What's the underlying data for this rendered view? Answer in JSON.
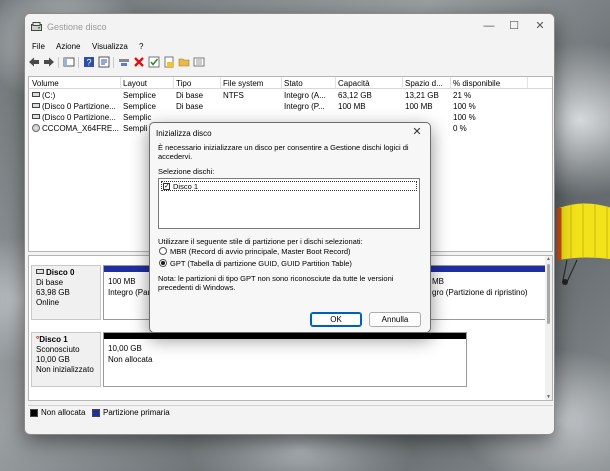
{
  "window": {
    "title": "Gestione disco",
    "minimize": "—",
    "maximize": "☐",
    "close": "✕"
  },
  "menu": [
    "File",
    "Azione",
    "Visualizza",
    "?"
  ],
  "toolbar": [
    "back-arrow-icon",
    "forward-arrow-icon",
    "show-hide-tree-icon",
    "help-icon",
    "properties-icon",
    "connect-icon",
    "delete-icon",
    "check-icon",
    "export-icon",
    "folder-icon",
    "view-list-icon"
  ],
  "volume_list": {
    "columns": [
      "Volume",
      "Layout",
      "Tipo",
      "File system",
      "Stato",
      "Capacità",
      "Spazio d...",
      "% disponibile"
    ],
    "rows": [
      [
        "(C:)",
        "Semplice",
        "Di base",
        "NTFS",
        "Integro (A...",
        "63,12 GB",
        "13,21 GB",
        "21 %"
      ],
      [
        "(Disco 0 Partizione...",
        "Semplice",
        "Di base",
        "",
        "Integro (P...",
        "100 MB",
        "100 MB",
        "100 %"
      ],
      [
        "(Disco 0 Partizione...",
        "Semplic",
        "",
        "",
        "",
        "",
        "",
        "100 %"
      ],
      [
        "CCCOMA_X64FRE...",
        "Sempli",
        "",
        "",
        "",
        "",
        "",
        "0 %"
      ]
    ]
  },
  "disks": [
    {
      "name": "Disco 0",
      "type": "Di base",
      "size": "63,98 GB",
      "status": "Online",
      "partitions": [
        {
          "size": "100 MB",
          "status": "Integro (Par"
        },
        {
          "size": "MB",
          "status": "gro (Partizione di ripristino)"
        }
      ]
    },
    {
      "name": "Disco 1",
      "type": "Sconosciuto",
      "size": "10,00 GB",
      "status": "Non inizializzato",
      "partitions": [
        {
          "size": "10,00 GB",
          "status": "Non allocata"
        }
      ]
    }
  ],
  "legend": [
    {
      "label": "Non allocata",
      "color": "#000000"
    },
    {
      "label": "Partizione primaria",
      "color": "#1f2fa0"
    }
  ],
  "dialog": {
    "title": "Inizializza disco",
    "close": "✕",
    "intro_line1": "È necessario inizializzare un disco per consentire a Gestione dischi logici di",
    "intro_line2": "accedervi.",
    "select_label": "Selezione dischi:",
    "disk_item": "Disco 1",
    "disk_checked": true,
    "style_label": "Utilizzare il seguente stile di partizione per i dischi selezionati:",
    "options": [
      {
        "label": "MBR (Record di avvio principale, Master Boot Record)",
        "selected": false
      },
      {
        "label": "GPT (Tabella di partizione GUID, GUID Partition Table)",
        "selected": true
      }
    ],
    "note_line1": "Nota: le partizioni di tipo GPT non sono riconosciute da tutte le versioni",
    "note_line2": "precedenti di Windows.",
    "ok": "OK",
    "cancel": "Annulla"
  },
  "colors": {
    "primary_partition": "#1f2fa0",
    "unallocated": "#000000",
    "accent": "#005fb8"
  }
}
